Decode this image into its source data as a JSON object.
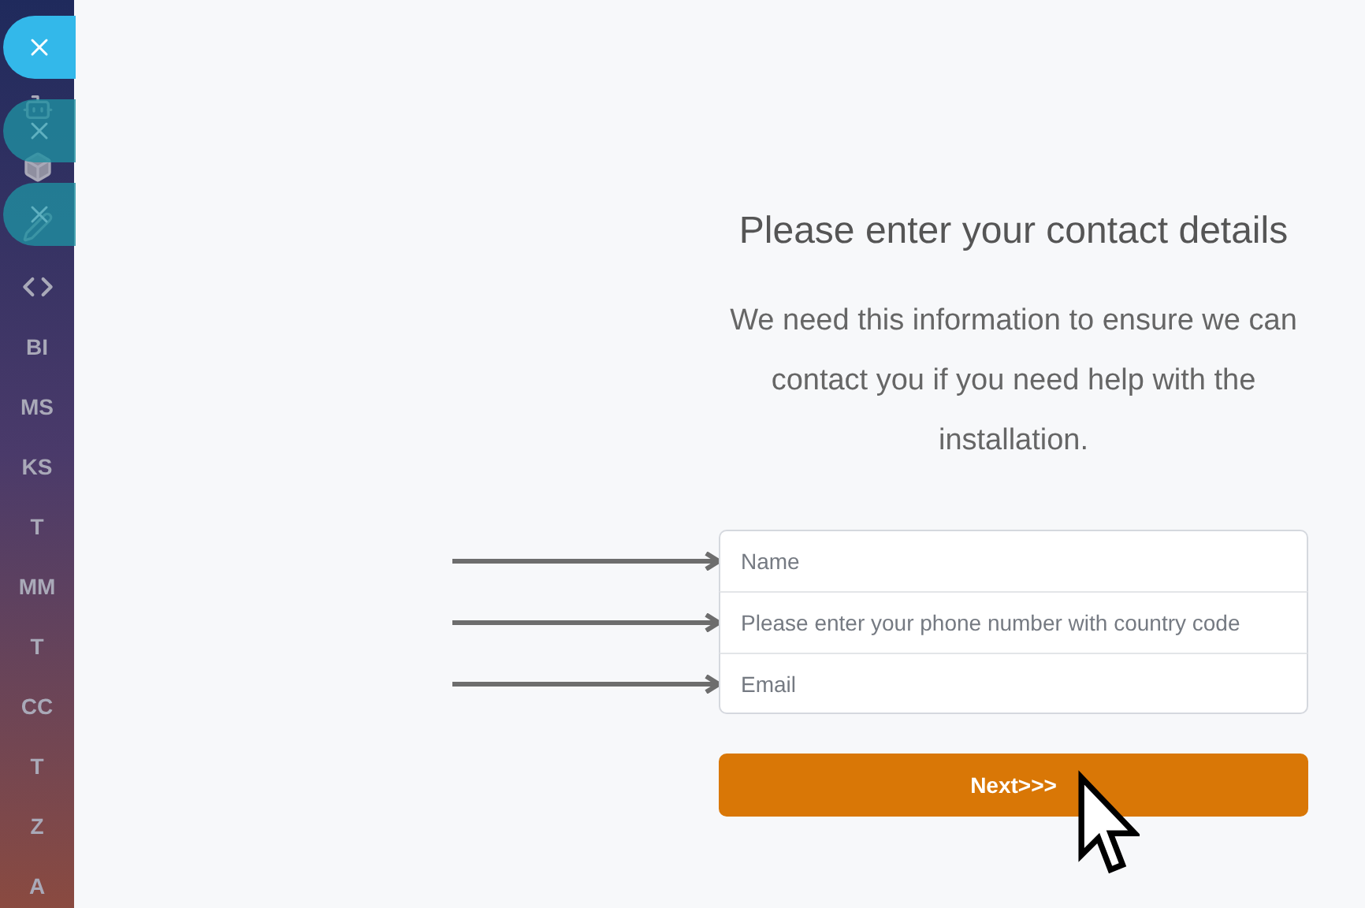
{
  "sidebar": {
    "items": [
      {
        "kind": "icon"
      },
      {
        "kind": "icon"
      },
      {
        "kind": "icon"
      },
      {
        "kind": "icon"
      },
      {
        "kind": "text",
        "label": "BI"
      },
      {
        "kind": "text",
        "label": "MS"
      },
      {
        "kind": "text",
        "label": "KS"
      },
      {
        "kind": "text",
        "label": "T"
      },
      {
        "kind": "text",
        "label": "MM"
      },
      {
        "kind": "text",
        "label": "T"
      },
      {
        "kind": "text",
        "label": "CC"
      },
      {
        "kind": "text",
        "label": "T"
      },
      {
        "kind": "text",
        "label": "Z"
      },
      {
        "kind": "text",
        "label": "A"
      }
    ]
  },
  "close_buttons": [
    {
      "selected": true
    },
    {
      "selected": false
    },
    {
      "selected": false
    }
  ],
  "heading": "Please enter your contact details",
  "description": "We need this information to ensure we can contact you if you need help with the installation.",
  "fields": [
    {
      "placeholder": "Name"
    },
    {
      "placeholder": "Please enter your phone number with country code"
    },
    {
      "placeholder": "Email"
    }
  ],
  "next_button": "Next>>>"
}
